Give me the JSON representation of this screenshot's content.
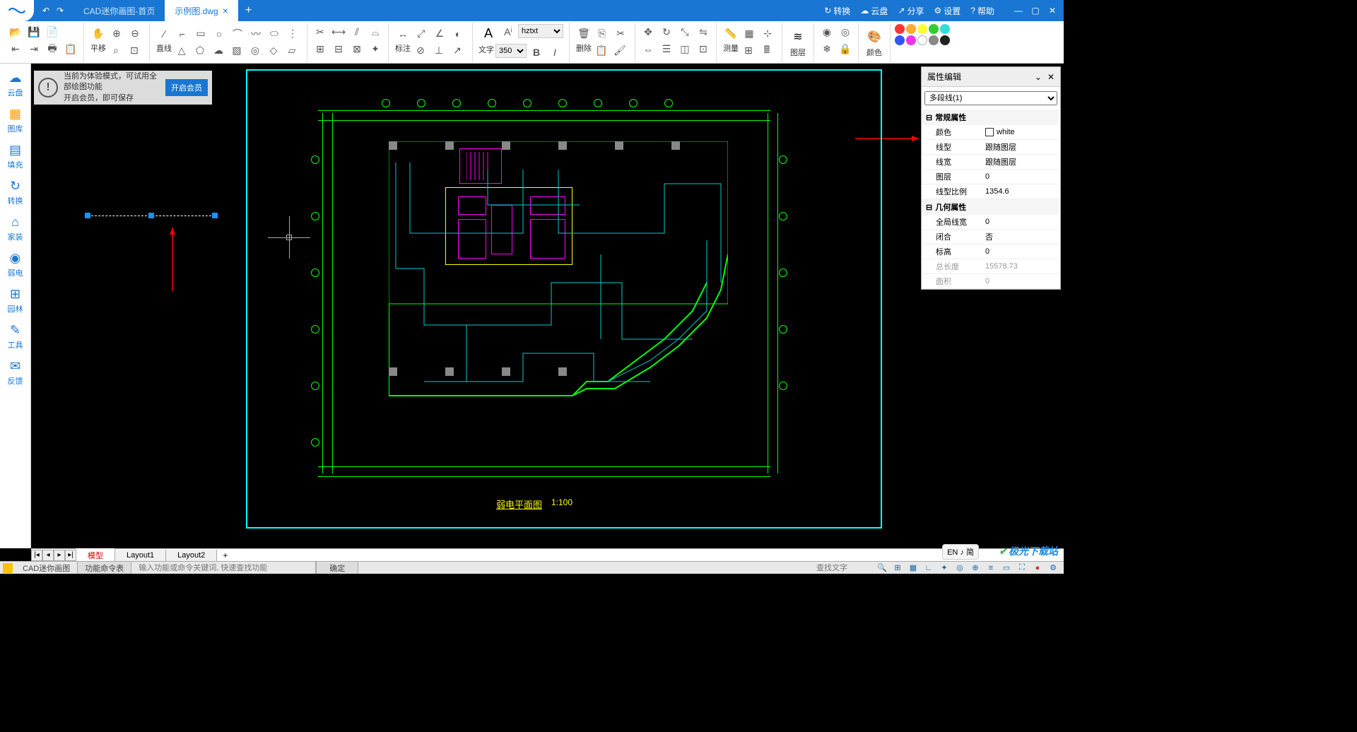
{
  "titlebar": {
    "tabs": [
      {
        "label": "CAD迷你画图-首页",
        "active": false
      },
      {
        "label": "示例图.dwg",
        "active": true
      }
    ],
    "right_items": [
      {
        "icon": "↻",
        "label": "转换"
      },
      {
        "icon": "☁",
        "label": "云盘"
      },
      {
        "icon": "↗",
        "label": "分享"
      },
      {
        "icon": "⚙",
        "label": "设置"
      },
      {
        "icon": "?",
        "label": "帮助"
      }
    ]
  },
  "ribbon": {
    "pan_label": "平移",
    "line_label": "直线",
    "annot_label": "标注",
    "text_label": "文字",
    "font_name": "hztxt",
    "font_size": "350",
    "delete_label": "删除",
    "measure_label": "测量",
    "layer_label": "图层",
    "color_label": "颜色",
    "palette": [
      "#ff0000",
      "#ffa500",
      "#ffff00",
      "#00ff00",
      "#00ffff",
      "#0000ff",
      "#ff00ff",
      "#ffffff",
      "#808080",
      "#000000"
    ]
  },
  "sidebar": [
    {
      "icon": "☁",
      "label": "云盘"
    },
    {
      "icon": "▦",
      "label": "图库"
    },
    {
      "icon": "▤",
      "label": "填充"
    },
    {
      "icon": "↻",
      "label": "转换"
    },
    {
      "icon": "⌂",
      "label": "家装"
    },
    {
      "icon": "⚡",
      "label": "弱电"
    },
    {
      "icon": "✿",
      "label": "园林"
    },
    {
      "icon": "✎",
      "label": "工具"
    },
    {
      "icon": "✉",
      "label": "反馈"
    }
  ],
  "notice": {
    "line1": "当前为体验模式，可试用全部绘图功能",
    "line2": "开启会员，即可保存",
    "button": "开启会员"
  },
  "drawing": {
    "title": "弱电平面图",
    "scale": "1:100"
  },
  "props": {
    "header": "属性编辑",
    "object": "多段线(1)",
    "sections": {
      "general": "常规属性",
      "geometry": "几何属性"
    },
    "rows": {
      "color_k": "颜色",
      "color_v": "white",
      "ltype_k": "线型",
      "ltype_v": "跟随图层",
      "lweight_k": "线宽",
      "lweight_v": "跟随图层",
      "layer_k": "图层",
      "layer_v": "0",
      "lscale_k": "线型比例",
      "lscale_v": "1354.6",
      "glwidth_k": "全局线宽",
      "glwidth_v": "0",
      "closed_k": "闭合",
      "closed_v": "否",
      "elev_k": "标高",
      "elev_v": "0",
      "length_k": "总长度",
      "length_v": "15578.73",
      "area_k": "面积",
      "area_v": "0"
    }
  },
  "bottom_tabs": {
    "model": "模型",
    "layout1": "Layout1",
    "layout2": "Layout2"
  },
  "statusbar": {
    "app": "CAD迷你画图",
    "cmdtab": "功能命令表",
    "cmd_placeholder": "输入功能或命令关键词, 快速查找功能",
    "ok": "确定",
    "find_placeholder": "查找文字"
  },
  "lang_badge": "EN ♪ 简",
  "watermark": "极光下载站"
}
